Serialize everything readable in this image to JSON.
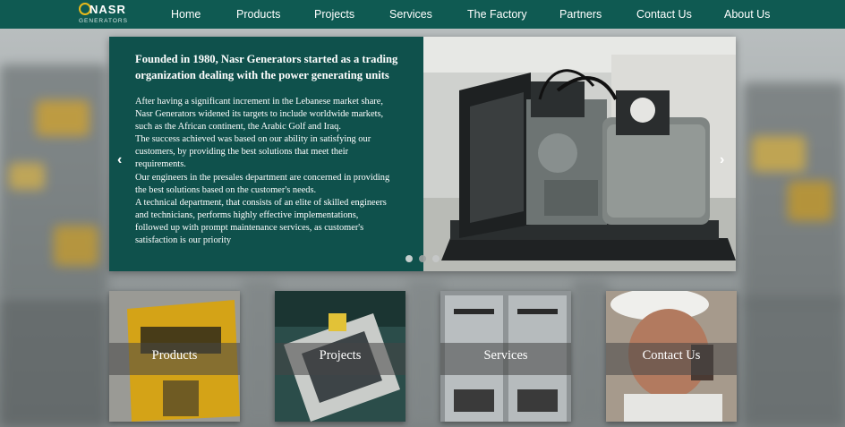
{
  "brand": {
    "name": "NASR",
    "sub": "GENERATORS"
  },
  "nav": {
    "items": [
      {
        "label": "Home"
      },
      {
        "label": "Products"
      },
      {
        "label": "Projects"
      },
      {
        "label": "Services"
      },
      {
        "label": "The Factory"
      },
      {
        "label": "Partners"
      },
      {
        "label": "Contact Us"
      },
      {
        "label": "About Us"
      }
    ]
  },
  "hero": {
    "title": "Founded in 1980, Nasr Generators started as a trading organization dealing with the power generating units",
    "lines": [
      "After having a significant increment in the Lebanese market share,",
      "Nasr Generators widened its targets to include worldwide markets,",
      "such as the African continent, the Arabic Golf and Iraq.",
      "The success achieved was based on our ability in satisfying our",
      "customers, by providing the best solutions that meet their",
      "requirements.",
      "Our engineers in the presales department are concerned in providing",
      "the best solutions based on the customer's needs.",
      "A technical department, that consists of an elite of skilled engineers",
      "and technicians, performs highly effective implementations,",
      "followed up with prompt maintenance services, as customer's",
      "satisfaction is our priority"
    ],
    "prev_glyph": "‹",
    "next_glyph": "›",
    "slides": 3,
    "active_slide": 1
  },
  "tiles": [
    {
      "label": "Products"
    },
    {
      "label": "Projects"
    },
    {
      "label": "Services"
    },
    {
      "label": "Contact Us"
    }
  ],
  "colors": {
    "nav": "#0f5a52",
    "hero_panel": "#0f514c",
    "accent": "#e8b91b"
  }
}
